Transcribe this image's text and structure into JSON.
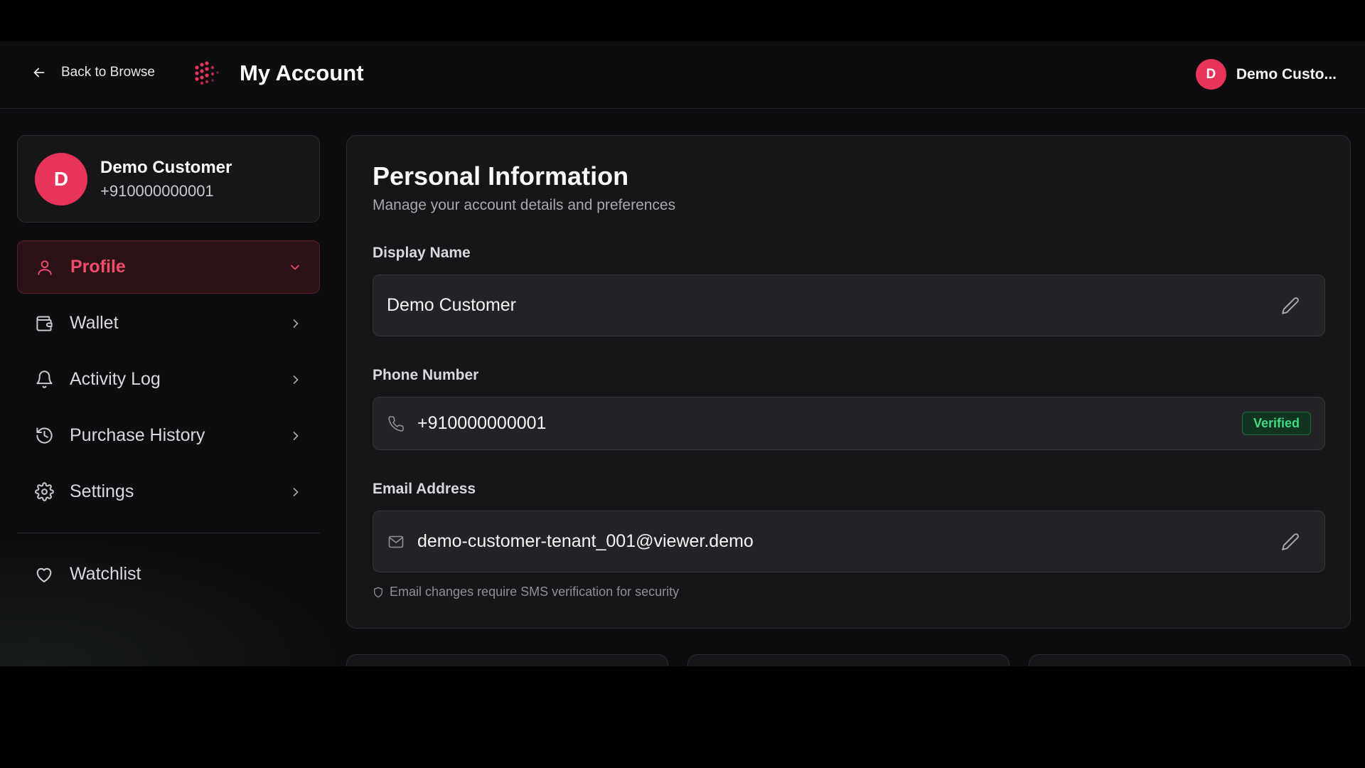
{
  "header": {
    "back_label": "Back to Browse",
    "title": "My Account",
    "user_avatar_initial": "D",
    "user_name": "Demo Custo..."
  },
  "profile": {
    "avatar_initial": "D",
    "name": "Demo Customer",
    "phone": "+910000000001"
  },
  "sidebar": {
    "items": [
      {
        "label": "Profile",
        "icon": "user-icon",
        "active": true
      },
      {
        "label": "Wallet",
        "icon": "wallet-icon"
      },
      {
        "label": "Activity Log",
        "icon": "bell-icon"
      },
      {
        "label": "Purchase History",
        "icon": "history-icon"
      },
      {
        "label": "Settings",
        "icon": "gear-icon"
      }
    ],
    "watchlist_label": "Watchlist"
  },
  "main": {
    "title": "Personal Information",
    "subtitle": "Manage your account details and preferences",
    "display_name": {
      "label": "Display Name",
      "value": "Demo Customer"
    },
    "phone": {
      "label": "Phone Number",
      "value": "+910000000001",
      "badge": "Verified"
    },
    "email": {
      "label": "Email Address",
      "value": "demo-customer-tenant_001@viewer.demo"
    },
    "email_hint": "Email changes require SMS verification for security"
  },
  "colors": {
    "accent": "#e8345a",
    "active_text": "#f14d6b",
    "verified": "#3ddc84",
    "background": "#0d0d0f",
    "card": "#161619"
  }
}
